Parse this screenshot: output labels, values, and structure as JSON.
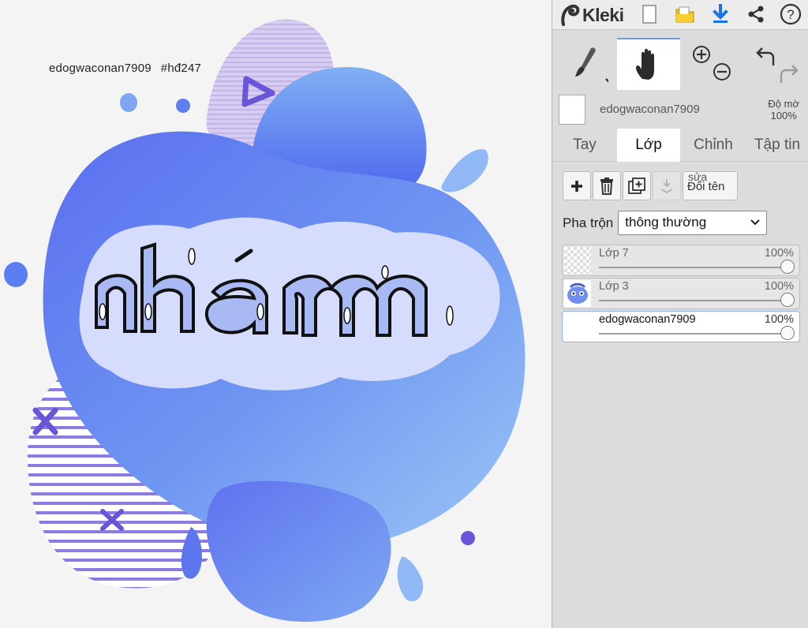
{
  "app": {
    "name": "Kleki",
    "toolbar_icons": [
      "new-file-icon",
      "open-folder-icon",
      "download-icon",
      "share-icon",
      "help-icon"
    ]
  },
  "tools": {
    "brush": "brush-icon",
    "hand": "hand-icon",
    "zoom_in": "zoom-in-icon",
    "zoom_out": "zoom-out-icon",
    "undo": "undo-icon",
    "redo": "redo-icon"
  },
  "color": {
    "primary_swatch": "#ffffff",
    "layer_label": "edogwaconan7909",
    "opacity_label_line1": "Độ mờ",
    "opacity_label_line2": "100%"
  },
  "tabs": [
    {
      "label": "Tay",
      "active": false
    },
    {
      "label": "Lớp",
      "active": true
    },
    {
      "label": "Chỉnh",
      "active": false
    },
    {
      "label": "Tập tin",
      "active": false
    }
  ],
  "layer_actions": {
    "add": "plus-icon",
    "delete": "trash-icon",
    "duplicate": "duplicate-icon",
    "merge_down": "merge-down-icon",
    "rename_tooltip": "sửa",
    "rename_label": "Đổi tên"
  },
  "blend": {
    "label": "Pha trộn",
    "value": "thông thường"
  },
  "layers": [
    {
      "name": "Lớp 7",
      "opacity": "100%",
      "opacity_value": 1.0,
      "active": false
    },
    {
      "name": "Lớp 3",
      "opacity": "100%",
      "opacity_value": 1.0,
      "active": false
    },
    {
      "name": "edogwaconan7909",
      "opacity": "100%",
      "opacity_value": 1.0,
      "active": true
    }
  ],
  "canvas": {
    "watermark_user": "edogwaconan7909",
    "watermark_tag": "#hđ247",
    "artwork_word": "nhám",
    "colors": {
      "blob_main": "#6f8ff0",
      "blob_light": "#8fb8f5",
      "cloud": "#d6dcfb",
      "lavender": "#c6b8ea",
      "accent_purple": "#6a55d8",
      "letter_fill": "#a9b9f4"
    }
  },
  "theme": {
    "panel_bg": "#dcdcdc",
    "active_tab_bg": "#ffffff",
    "accent_blue": "#1a73e8"
  }
}
